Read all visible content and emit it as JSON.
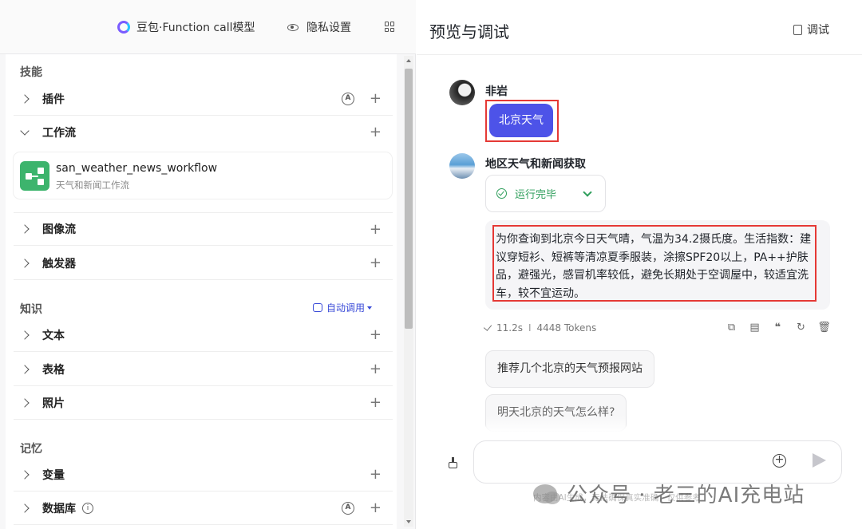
{
  "left_header": {
    "model_label": "豆包·Function call模型",
    "privacy_label": "隐私设置"
  },
  "skills": {
    "section_label": "技能",
    "plugin_label": "插件",
    "workflow_label": "工作流",
    "workflow_item": {
      "name": "san_weather_news_workflow",
      "description": "天气和新闻工作流"
    },
    "imageflow_label": "图像流",
    "trigger_label": "触发器"
  },
  "knowledge": {
    "section_label": "知识",
    "auto_call_label": "自动调用",
    "text_label": "文本",
    "table_label": "表格",
    "photo_label": "照片"
  },
  "memory": {
    "section_label": "记忆",
    "variable_label": "变量",
    "database_label": "数据库"
  },
  "preview": {
    "title": "预览与调试",
    "debug_label": "调试"
  },
  "chat": {
    "user_name": "非岩",
    "user_message": "北京天气",
    "bot_name": "地区天气和新闻获取",
    "status_text": "运行完毕",
    "answer": "为你查询到北京今日天气晴，气温为34.2摄氏度。生活指数：建议穿短衫、短裤等清凉夏季服装，涂擦SPF20以上，PA++护肤品，避强光，感冒机率较低，避免长期处于空调屋中，较适宜洗车，较不宜运动。",
    "time": "11.2s",
    "tokens": "4448 Tokens",
    "suggestions": [
      "推荐几个北京的天气预报网站",
      "明天北京的天气怎么样?"
    ]
  },
  "watermark": {
    "main": "公众号 · 老三的AI充电站",
    "sub": "内容由AI生成，无法确保真实准确，仅供参考"
  },
  "colors": {
    "accent": "#4d53e8",
    "success": "#2e9e5b",
    "highlight_border": "#e53935"
  }
}
